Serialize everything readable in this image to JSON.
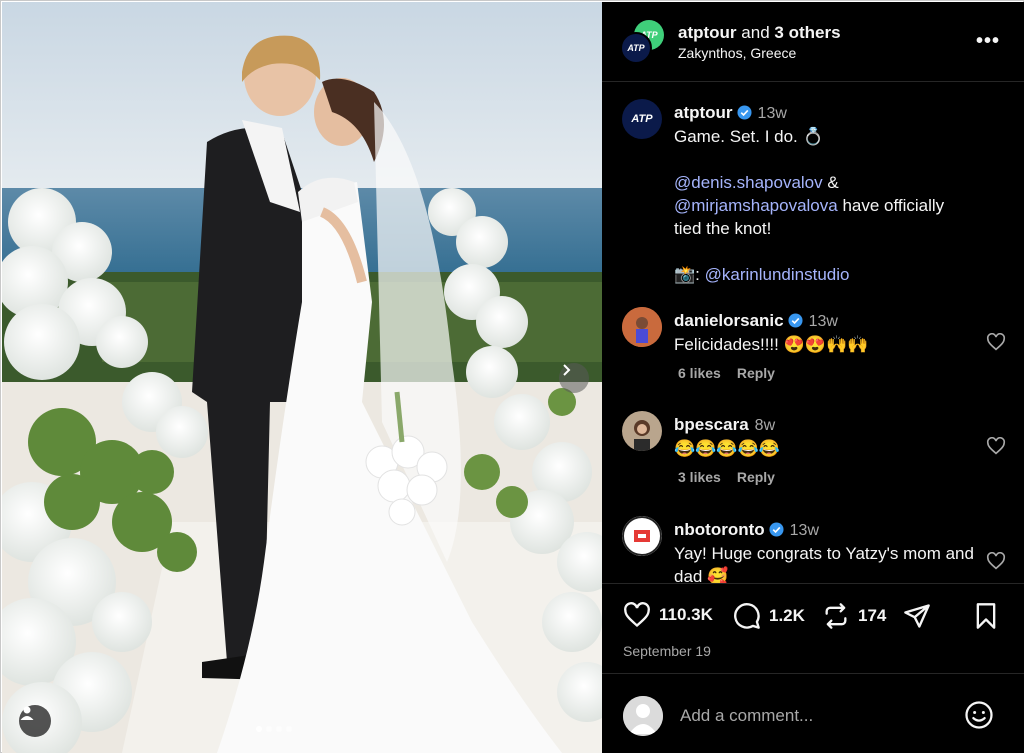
{
  "header": {
    "account": "atptour",
    "others_connector": "and",
    "others": "3 others",
    "location": "Zakynthos, Greece",
    "avatar_text": "ATP"
  },
  "caption": {
    "username": "atptour",
    "time": "13w",
    "line1": "Game. Set. I do. 💍",
    "mention1": "@denis.shapovalov",
    "amp": " &",
    "mention2": "@mirjamshapovalova",
    "rest": " have officially tied the knot!",
    "camera": "📸: ",
    "credit": "@karinlundinstudio"
  },
  "comments": [
    {
      "username": "danielorsanic",
      "verified": true,
      "time": "13w",
      "text": "Felicidades!!!! 😍😍🙌🙌",
      "likes": "6 likes",
      "reply": "Reply"
    },
    {
      "username": "bpescara",
      "verified": false,
      "time": "8w",
      "text": "😂😂😂😂😂",
      "likes": "3 likes",
      "reply": "Reply"
    },
    {
      "username": "nbotoronto",
      "verified": true,
      "time": "13w",
      "text": "Yay! Huge congrats to Yatzy's mom and dad 🥰"
    }
  ],
  "actions": {
    "likes": "110.3K",
    "comments": "1.2K",
    "reposts": "174"
  },
  "date": "September 19",
  "comment_input": {
    "placeholder": "Add a comment..."
  },
  "colors": {
    "panel_bg": "#000000",
    "link": "#a5b4fc",
    "muted": "#a8a8a8",
    "verified": "#3897f0"
  }
}
